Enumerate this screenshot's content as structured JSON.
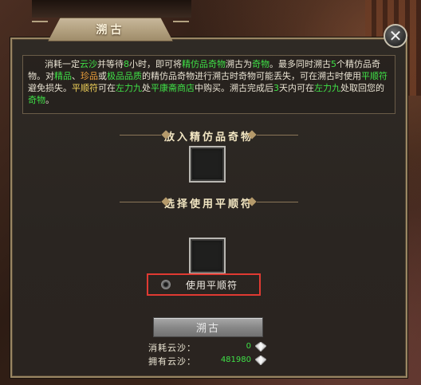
{
  "window": {
    "title": "溯古",
    "close_label": "✕"
  },
  "description": {
    "parts": [
      {
        "text": "消耗一定",
        "style": "normal"
      },
      {
        "text": "云沙",
        "style": "green"
      },
      {
        "text": "并等待",
        "style": "normal"
      },
      {
        "text": "8",
        "style": "green"
      },
      {
        "text": "小时，即可将",
        "style": "normal"
      },
      {
        "text": "精仿品奇物",
        "style": "green"
      },
      {
        "text": "溯古为",
        "style": "normal"
      },
      {
        "text": "奇物",
        "style": "green"
      },
      {
        "text": "。最多同时溯古",
        "style": "normal"
      },
      {
        "text": "5",
        "style": "green"
      },
      {
        "text": "个精仿品奇物。对",
        "style": "normal"
      },
      {
        "text": "精品",
        "style": "green"
      },
      {
        "text": "、",
        "style": "normal"
      },
      {
        "text": "珍品",
        "style": "orange"
      },
      {
        "text": "或",
        "style": "normal"
      },
      {
        "text": "极品品质",
        "style": "green"
      },
      {
        "text": "的精仿品奇物进行溯古时奇物可能丢失，可在溯古时使用",
        "style": "normal"
      },
      {
        "text": "平顺符",
        "style": "green"
      },
      {
        "text": "避免损失。",
        "style": "normal"
      },
      {
        "text": "平顺符",
        "style": "yellow"
      },
      {
        "text": "可在",
        "style": "normal"
      },
      {
        "text": "左力九",
        "style": "green"
      },
      {
        "text": "处",
        "style": "normal"
      },
      {
        "text": "平康斋商店",
        "style": "green"
      },
      {
        "text": "中购买。溯古完成后",
        "style": "normal"
      },
      {
        "text": "3",
        "style": "green"
      },
      {
        "text": "天内可在",
        "style": "normal"
      },
      {
        "text": "左力九",
        "style": "green"
      },
      {
        "text": "处取回您的",
        "style": "normal"
      },
      {
        "text": "奇物",
        "style": "green"
      },
      {
        "text": "。",
        "style": "normal"
      }
    ]
  },
  "sections": {
    "place_item": "放入精仿品奇物",
    "select_charm": "选择使用平顺符"
  },
  "charm_option": {
    "label": "使用平顺符",
    "selected": false
  },
  "action_button": {
    "label": "溯古",
    "enabled": false
  },
  "costs": {
    "consume_label": "消耗云沙：",
    "consume_value": "0",
    "owned_label": "拥有云沙：",
    "owned_value": "481980"
  },
  "colors": {
    "highlight_green": "#3fe047",
    "highlight_orange": "#f0a13a",
    "highlight_yellow": "#f2d35a",
    "focus_outline": "#e03a32"
  },
  "icons": {
    "close": "close-icon",
    "radio": "radio-icon",
    "currency": "gem-icon"
  }
}
